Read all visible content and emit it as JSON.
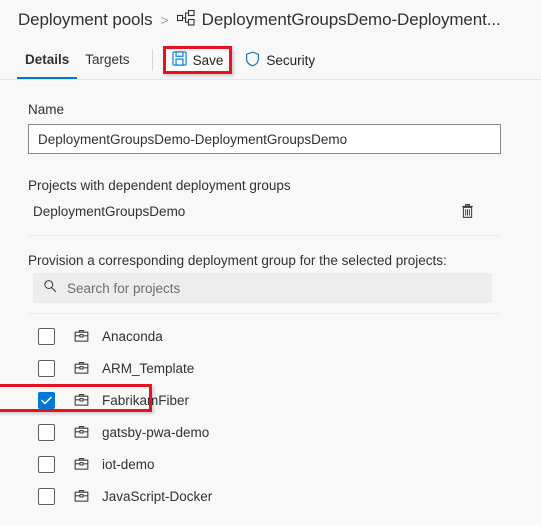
{
  "breadcrumb": {
    "root": "Deployment pools",
    "separator": ">",
    "current": "DeploymentGroupsDemo-Deployment...",
    "icon": "deployment-pool-icon"
  },
  "tabs": [
    {
      "label": "Details",
      "active": true
    },
    {
      "label": "Targets",
      "active": false
    }
  ],
  "toolbar": {
    "save_label": "Save",
    "save_icon": "save-floppy-icon",
    "security_label": "Security",
    "security_icon": "shield-icon"
  },
  "form": {
    "name_label": "Name",
    "name_value": "DeploymentGroupsDemo-DeploymentGroupsDemo",
    "name_placeholder": "Name",
    "dependent_header": "Projects with dependent deployment groups",
    "dependent_projects": [
      {
        "name": "DeploymentGroupsDemo",
        "delete_icon": "trash-icon"
      }
    ],
    "provision_label": "Provision a corresponding deployment group for the selected projects:",
    "search_placeholder": "Search for projects",
    "search_value": "",
    "search_icon": "search-icon"
  },
  "projects": [
    {
      "name": "Anaconda",
      "checked": false,
      "highlighted": false,
      "icon": "briefcase-icon"
    },
    {
      "name": "ARM_Template",
      "checked": false,
      "highlighted": false,
      "icon": "briefcase-icon"
    },
    {
      "name": "FabrikamFiber",
      "checked": true,
      "highlighted": true,
      "icon": "briefcase-icon"
    },
    {
      "name": "gatsby-pwa-demo",
      "checked": false,
      "highlighted": false,
      "icon": "briefcase-icon"
    },
    {
      "name": "iot-demo",
      "checked": false,
      "highlighted": false,
      "icon": "briefcase-icon"
    },
    {
      "name": "JavaScript-Docker",
      "checked": false,
      "highlighted": false,
      "icon": "briefcase-icon"
    }
  ],
  "colors": {
    "accent": "#0078d4",
    "highlight": "#e81123",
    "page_background": "#f8f8f8",
    "input_background": "#ffffff",
    "search_background": "#ededed",
    "text": "#323130"
  }
}
